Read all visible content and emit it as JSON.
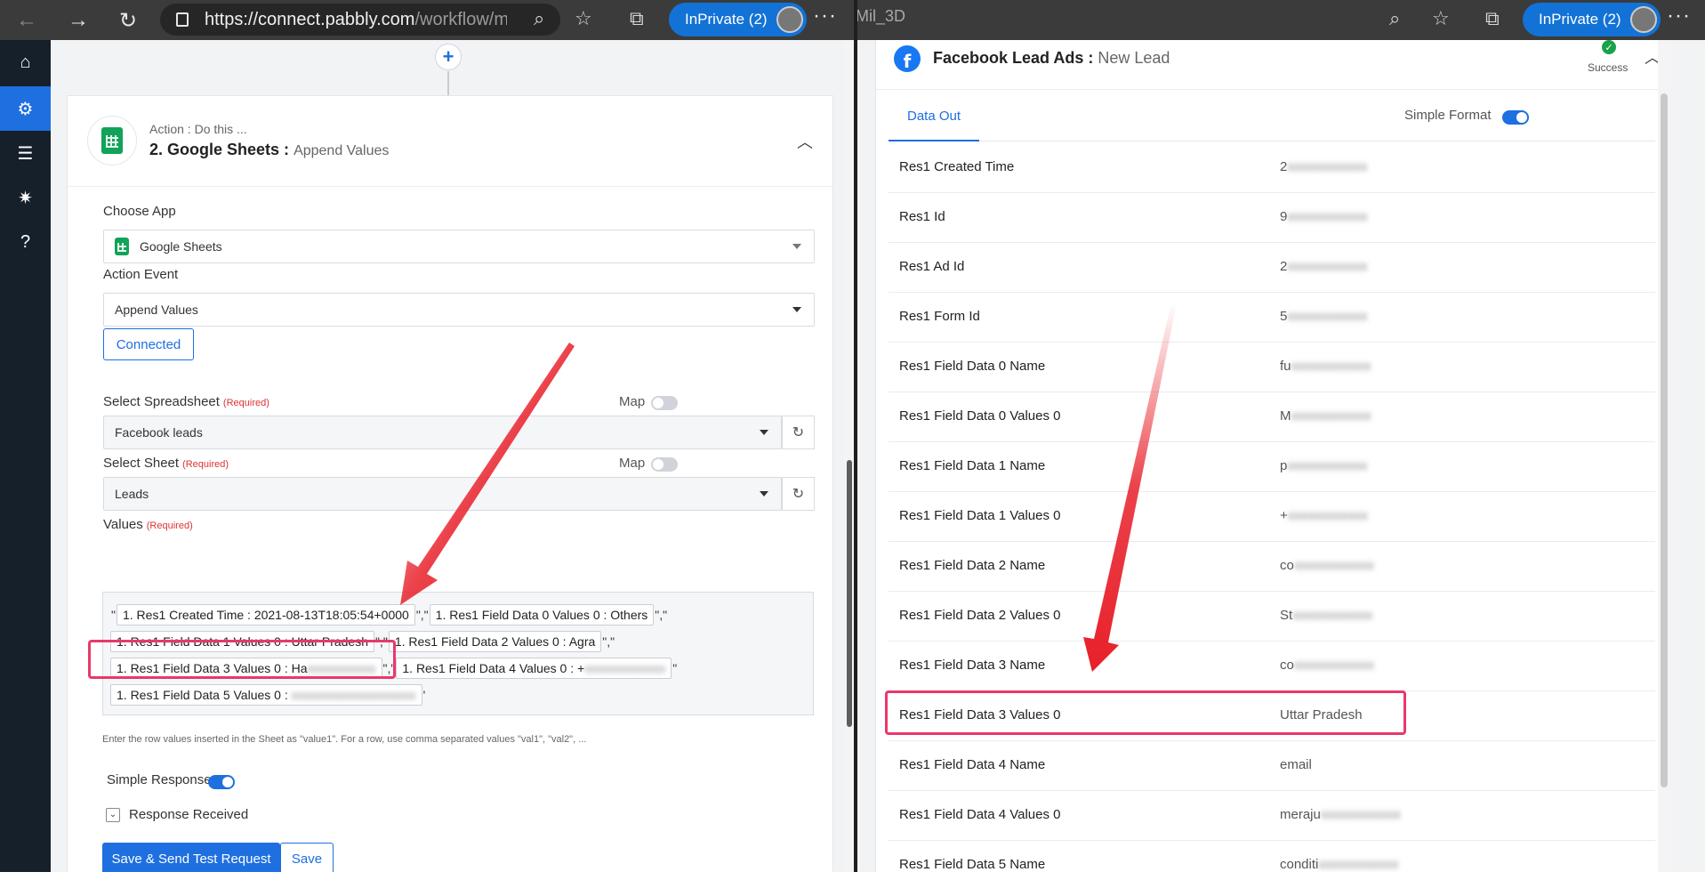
{
  "left_browser": {
    "url_main": "https://connect.pabbly.com",
    "url_rest": "/workflow/map...",
    "inprivate_label": "InPrivate (2)",
    "more_label": "···"
  },
  "right_browser": {
    "tab_title": "Mil_3D",
    "inprivate_label": "InPrivate (2)",
    "more_label": "···"
  },
  "sidebar": {
    "items": [
      {
        "icon": "home-icon",
        "active": false
      },
      {
        "icon": "workflow-icon",
        "active": true
      },
      {
        "icon": "list-icon",
        "active": false
      },
      {
        "icon": "gear-icon",
        "active": false
      },
      {
        "icon": "help-icon",
        "active": false
      }
    ]
  },
  "action": {
    "subtitle": "Action : Do this ...",
    "step": "2. Google Sheets :",
    "event": "Append Values",
    "choose_app_label": "Choose App",
    "choose_app_value": "Google Sheets",
    "action_event_label": "Action Event",
    "action_event_value": "Append Values",
    "connected_label": "Connected",
    "spreadsheet_label": "Select Spreadsheet",
    "required": "(Required)",
    "map_label": "Map",
    "spreadsheet_value": "Facebook leads",
    "sheet_label": "Select Sheet",
    "sheet_value": "Leads",
    "values_label": "Values",
    "values_chips": {
      "c1": "1. Res1 Created Time : 2021-08-13T18:05:54+0000",
      "c2": "1. Res1 Field Data 0 Values 0 : Others",
      "c3": "1. Res1 Field Data 1 Values 0 : Uttar Pradesh",
      "c4": "1. Res1 Field Data 2 Values 0 : Agra",
      "c5": "1. Res1 Field Data 3 Values 0 : Ha",
      "c6": "1. Res1 Field Data 4 Values 0 : +",
      "c7": "1. Res1 Field Data 5 Values 0 :"
    },
    "values_help": "Enter the row values inserted in the Sheet as \"value1\". For a row, use comma separated values \"val1\", \"val2\", ...",
    "simple_response_label": "Simple Response",
    "response_received_label": "Response Received",
    "save_send_label": "Save & Send Test Request",
    "save_label": "Save"
  },
  "trigger": {
    "app": "Facebook Lead Ads :",
    "event": "New Lead",
    "status": "Success",
    "tab_label": "Data Out",
    "simple_format_label": "Simple Format",
    "rows": [
      {
        "key": "Res1 Created Time",
        "value": "2"
      },
      {
        "key": "Res1 Id",
        "value": "9"
      },
      {
        "key": "Res1 Ad Id",
        "value": "2"
      },
      {
        "key": "Res1 Form Id",
        "value": "5"
      },
      {
        "key": "Res1 Field Data 0 Name",
        "value": "fu"
      },
      {
        "key": "Res1 Field Data 0 Values 0",
        "value": "M"
      },
      {
        "key": "Res1 Field Data 1 Name",
        "value": "p"
      },
      {
        "key": "Res1 Field Data 1 Values 0",
        "value": "+"
      },
      {
        "key": "Res1 Field Data 2 Name",
        "value": "co"
      },
      {
        "key": "Res1 Field Data 2 Values 0",
        "value": "St"
      },
      {
        "key": "Res1 Field Data 3 Name",
        "value": "co"
      },
      {
        "key": "Res1 Field Data 3 Values 0",
        "value": "Uttar Pradesh"
      },
      {
        "key": "Res1 Field Data 4 Name",
        "value": "email"
      },
      {
        "key": "Res1 Field Data 4 Values 0",
        "value": "meraju"
      },
      {
        "key": "Res1 Field Data 5 Name",
        "value": "conditi"
      }
    ]
  },
  "colors": {
    "accent": "#1e6fe0",
    "highlight": "#e8396a",
    "arrow": "#e8202a",
    "sheets_green": "#12a35a",
    "facebook_blue": "#1877f2",
    "sidebar_bg": "#15202b"
  }
}
